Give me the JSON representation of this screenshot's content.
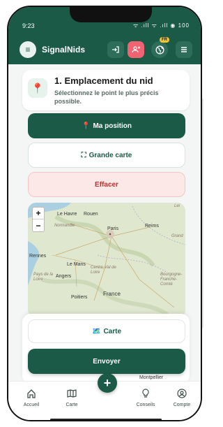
{
  "status": {
    "time": "9:23",
    "icons_text": "ᯤ .ıll ᯤ .ıll ◉ 100"
  },
  "appbar": {
    "title": "SignalNids",
    "lang_badge": "FR"
  },
  "step": {
    "title": "1. Emplacement du nid",
    "hint": "Sélectionnez le point le plus précis possible."
  },
  "buttons": {
    "position": "Ma position",
    "bigmap": "Grande carte",
    "clear": "Effacer",
    "carte": "Carte",
    "send": "Envoyer"
  },
  "map": {
    "zoom_in": "+",
    "zoom_out": "−",
    "labels": {
      "le_havre": "Le Havre",
      "rouen": "Rouen",
      "normandie": "Normandie",
      "paris": "Paris",
      "reims": "Reims",
      "grand": "Grand",
      "rennes": "Rennes",
      "le_mans": "Le Mans",
      "centre": "Centre-Val de Loire",
      "pays": "Pays de la Loire",
      "angers": "Angers",
      "bourgogne": "Bourgogne-Franche-Comté",
      "poitiers": "Poitiers",
      "france": "France",
      "montpellier": "Montpellier",
      "lei": "Lei"
    }
  },
  "tabs": [
    {
      "label": "Accueil"
    },
    {
      "label": "Carte"
    },
    {
      "label": "Conseils"
    },
    {
      "label": "Compte"
    }
  ],
  "colors": {
    "primary": "#1a5a47",
    "danger_text": "#c42b2b",
    "danger_bg": "#fde8e8",
    "accent_pink": "#f06373",
    "badge": "#f4c430"
  }
}
